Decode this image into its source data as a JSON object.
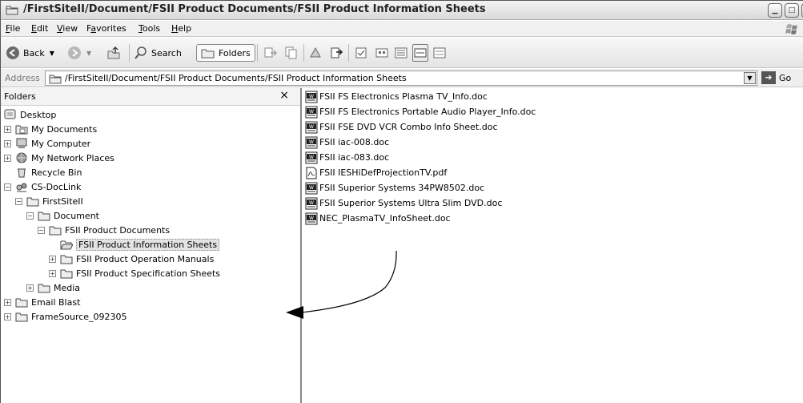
{
  "window": {
    "title": "/FirstSiteII/Document/FSII Product Documents/FSII Product Information Sheets"
  },
  "menu": [
    {
      "label": "File",
      "key": "F",
      "rest": "ile"
    },
    {
      "label": "Edit",
      "key": "E",
      "rest": "dit"
    },
    {
      "label": "View",
      "key": "V",
      "rest": "iew"
    },
    {
      "label": "Favorites",
      "key": "a",
      "pre": "F",
      "rest": "vorites"
    },
    {
      "label": "Tools",
      "key": "T",
      "rest": "ools"
    },
    {
      "label": "Help",
      "key": "H",
      "rest": "elp"
    }
  ],
  "toolbar": {
    "back_label": "Back",
    "search_label": "Search",
    "folders_label": "Folders"
  },
  "address": {
    "label": "Address",
    "value": "/FirstSiteII/Document/FSII Product Documents/FSII Product Information Sheets",
    "go_label": "Go"
  },
  "folders_pane": {
    "title": "Folders",
    "close_glyph": "×",
    "tree": [
      {
        "label": "Desktop",
        "icon": "desktop-icon"
      },
      {
        "label": "My Documents",
        "icon": "my-documents-icon"
      },
      {
        "label": "My Computer",
        "icon": "my-computer-icon"
      },
      {
        "label": "My Network Places",
        "icon": "network-places-icon"
      },
      {
        "label": "Recycle Bin",
        "icon": "recycle-bin-icon"
      },
      {
        "label": "CS-DocLink",
        "icon": "cs-doclink-icon"
      },
      {
        "label": "FirstSiteII",
        "icon": "folder-icon"
      },
      {
        "label": "Document",
        "icon": "folder-icon"
      },
      {
        "label": "FSII Product Documents",
        "icon": "folder-icon"
      },
      {
        "label": "FSII Product Information Sheets",
        "icon": "open-folder-icon"
      },
      {
        "label": "FSII Product Operation Manuals",
        "icon": "folder-icon"
      },
      {
        "label": "FSII Product Specification Sheets",
        "icon": "folder-icon"
      },
      {
        "label": "Media",
        "icon": "folder-icon"
      },
      {
        "label": "Email Blast",
        "icon": "folder-icon"
      },
      {
        "label": "FrameSource_092305",
        "icon": "folder-icon"
      }
    ]
  },
  "files": [
    {
      "name": "FSII FS Electronics Plasma TV_Info.doc",
      "icon": "word-doc-icon"
    },
    {
      "name": "FSII FS Electronics Portable Audio Player_Info.doc",
      "icon": "word-doc-icon"
    },
    {
      "name": "FSII FSE DVD VCR Combo Info Sheet.doc",
      "icon": "word-doc-icon"
    },
    {
      "name": "FSII iac-008.doc",
      "icon": "word-doc-icon"
    },
    {
      "name": "FSII iac-083.doc",
      "icon": "word-doc-icon"
    },
    {
      "name": "FSII IESHiDefProjectionTV.pdf",
      "icon": "pdf-icon"
    },
    {
      "name": "FSII Superior Systems 34PW8502.doc",
      "icon": "word-doc-icon"
    },
    {
      "name": "FSII Superior Systems Ultra Slim DVD.doc",
      "icon": "word-doc-icon"
    },
    {
      "name": "NEC_PlasmaTV_InfoSheet.doc",
      "icon": "word-doc-icon"
    }
  ]
}
